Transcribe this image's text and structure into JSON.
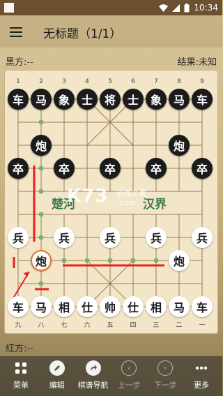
{
  "status": {
    "time": "10:34"
  },
  "appbar": {
    "title": "无标题（1/1）"
  },
  "black_side": {
    "label": "黑方:",
    "name": "--",
    "result_label": "结果:",
    "result": "未知"
  },
  "red_side": {
    "label": "红方:",
    "name": "--"
  },
  "board": {
    "top_numbers": [
      "1",
      "2",
      "3",
      "4",
      "5",
      "6",
      "7",
      "8",
      "9"
    ],
    "bottom_numbers": [
      "九",
      "八",
      "七",
      "六",
      "五",
      "四",
      "三",
      "二",
      "一"
    ],
    "river_left": "楚河",
    "river_right": "汉界",
    "watermark": "K73",
    "watermark_sub": "游戏之家",
    "watermark_domain": ".com",
    "pieces": [
      {
        "t": "车",
        "side": "black",
        "c": 0,
        "r": 0
      },
      {
        "t": "马",
        "side": "black",
        "c": 1,
        "r": 0
      },
      {
        "t": "象",
        "side": "black",
        "c": 2,
        "r": 0
      },
      {
        "t": "士",
        "side": "black",
        "c": 3,
        "r": 0
      },
      {
        "t": "将",
        "side": "black",
        "c": 4,
        "r": 0
      },
      {
        "t": "士",
        "side": "black",
        "c": 5,
        "r": 0
      },
      {
        "t": "象",
        "side": "black",
        "c": 6,
        "r": 0
      },
      {
        "t": "马",
        "side": "black",
        "c": 7,
        "r": 0
      },
      {
        "t": "车",
        "side": "black",
        "c": 8,
        "r": 0
      },
      {
        "t": "炮",
        "side": "black",
        "c": 1,
        "r": 2
      },
      {
        "t": "炮",
        "side": "black",
        "c": 7,
        "r": 2
      },
      {
        "t": "卒",
        "side": "black",
        "c": 0,
        "r": 3
      },
      {
        "t": "卒",
        "side": "black",
        "c": 2,
        "r": 3
      },
      {
        "t": "卒",
        "side": "black",
        "c": 4,
        "r": 3
      },
      {
        "t": "卒",
        "side": "black",
        "c": 6,
        "r": 3
      },
      {
        "t": "卒",
        "side": "black",
        "c": 8,
        "r": 3
      },
      {
        "t": "兵",
        "side": "red",
        "c": 0,
        "r": 6
      },
      {
        "t": "兵",
        "side": "red",
        "c": 2,
        "r": 6
      },
      {
        "t": "兵",
        "side": "red",
        "c": 4,
        "r": 6
      },
      {
        "t": "兵",
        "side": "red",
        "c": 6,
        "r": 6
      },
      {
        "t": "兵",
        "side": "red",
        "c": 8,
        "r": 6
      },
      {
        "t": "炮",
        "side": "red",
        "c": 1,
        "r": 7,
        "selected": true
      },
      {
        "t": "炮",
        "side": "red",
        "c": 7,
        "r": 7
      },
      {
        "t": "车",
        "side": "red",
        "c": 0,
        "r": 9
      },
      {
        "t": "马",
        "side": "red",
        "c": 1,
        "r": 9
      },
      {
        "t": "相",
        "side": "red",
        "c": 2,
        "r": 9
      },
      {
        "t": "仕",
        "side": "red",
        "c": 3,
        "r": 9
      },
      {
        "t": "帅",
        "side": "red",
        "c": 4,
        "r": 9
      },
      {
        "t": "仕",
        "side": "red",
        "c": 5,
        "r": 9
      },
      {
        "t": "相",
        "side": "red",
        "c": 6,
        "r": 9
      },
      {
        "t": "马",
        "side": "red",
        "c": 7,
        "r": 9
      },
      {
        "t": "车",
        "side": "red",
        "c": 8,
        "r": 9
      }
    ],
    "hint_dots": [
      [
        1,
        1
      ],
      [
        1,
        3
      ],
      [
        1,
        4
      ],
      [
        1,
        5
      ],
      [
        1,
        6
      ],
      [
        1,
        8
      ],
      [
        2,
        7
      ],
      [
        3,
        7
      ],
      [
        4,
        7
      ],
      [
        5,
        7
      ],
      [
        6,
        7
      ]
    ]
  },
  "toolbar": {
    "items": [
      {
        "label": "菜单",
        "icon": "grid-icon",
        "enabled": true
      },
      {
        "label": "编辑",
        "icon": "edit-icon",
        "enabled": true
      },
      {
        "label": "棋谱导航",
        "icon": "share-icon",
        "enabled": true
      },
      {
        "label": "上一步",
        "icon": "prev-icon",
        "enabled": false
      },
      {
        "label": "下一步",
        "icon": "next-icon",
        "enabled": false
      },
      {
        "label": "更多",
        "icon": "more-icon",
        "enabled": true
      }
    ]
  },
  "colors": {
    "accent": "#e8742a",
    "annotation": "#e82020",
    "hint": "#7fb069"
  }
}
